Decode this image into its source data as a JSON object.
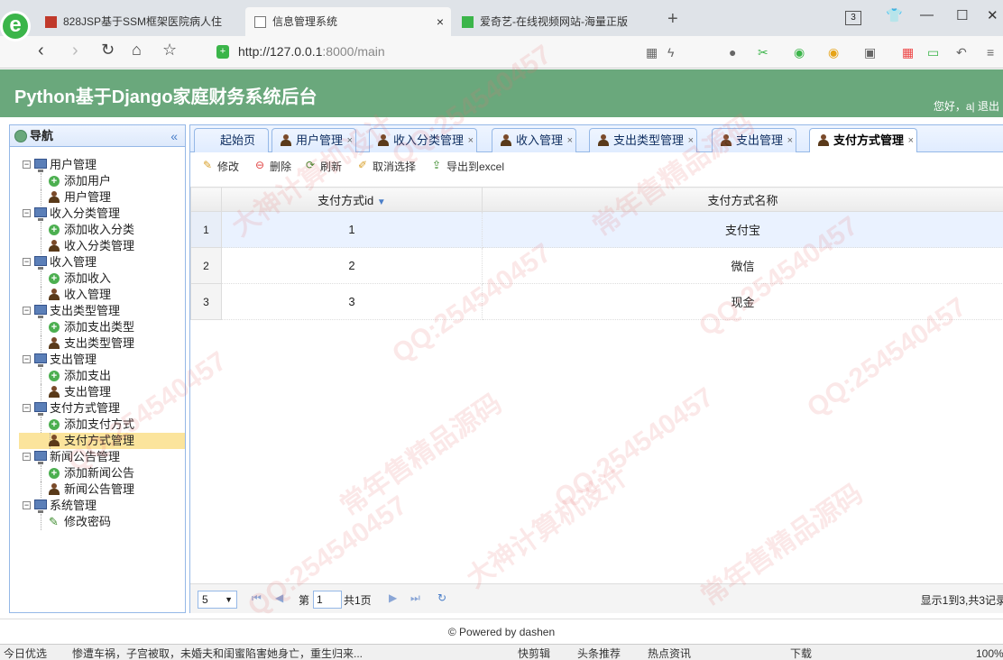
{
  "browser": {
    "tabs": [
      {
        "title": "828JSP基于SSM框架医院病人住",
        "active": false
      },
      {
        "title": "信息管理系统",
        "active": true
      },
      {
        "title": "爱奇艺-在线视频网站-海量正版",
        "active": false
      }
    ],
    "tab_count": "3",
    "url_host": "http://127.0.0.1",
    "url_rest": ":8000/main",
    "status_items": [
      "今日优选",
      "惨遭车祸，子宫被取，未婚夫和闺蜜陷害她身亡，重生归来...",
      "快剪辑",
      "头条推荐",
      "热点资讯",
      "下载",
      "100%"
    ]
  },
  "app": {
    "title": "Python基于Django家庭财务系统后台",
    "welcome": "您好，a| 退出"
  },
  "nav": {
    "heading": "导航",
    "groups": [
      {
        "label": "用户管理",
        "items": [
          {
            "label": "添加用户",
            "type": "add"
          },
          {
            "label": "用户管理",
            "type": "user"
          }
        ]
      },
      {
        "label": "收入分类管理",
        "items": [
          {
            "label": "添加收入分类",
            "type": "add"
          },
          {
            "label": "收入分类管理",
            "type": "user"
          }
        ]
      },
      {
        "label": "收入管理",
        "items": [
          {
            "label": "添加收入",
            "type": "add"
          },
          {
            "label": "收入管理",
            "type": "user"
          }
        ]
      },
      {
        "label": "支出类型管理",
        "items": [
          {
            "label": "添加支出类型",
            "type": "add"
          },
          {
            "label": "支出类型管理",
            "type": "user"
          }
        ]
      },
      {
        "label": "支出管理",
        "items": [
          {
            "label": "添加支出",
            "type": "add"
          },
          {
            "label": "支出管理",
            "type": "user"
          }
        ]
      },
      {
        "label": "支付方式管理",
        "items": [
          {
            "label": "添加支付方式",
            "type": "add"
          },
          {
            "label": "支付方式管理",
            "type": "user",
            "selected": true
          }
        ]
      },
      {
        "label": "新闻公告管理",
        "items": [
          {
            "label": "添加新闻公告",
            "type": "add"
          },
          {
            "label": "新闻公告管理",
            "type": "user"
          }
        ]
      },
      {
        "label": "系统管理",
        "items": [
          {
            "label": "修改密码",
            "type": "pen"
          }
        ]
      }
    ]
  },
  "tabs": [
    {
      "label": "起始页",
      "closable": false,
      "active": false
    },
    {
      "label": "用户管理",
      "closable": true,
      "active": false
    },
    {
      "label": "收入分类管理",
      "closable": true,
      "active": false
    },
    {
      "label": "收入管理",
      "closable": true,
      "active": false
    },
    {
      "label": "支出类型管理",
      "closable": true,
      "active": false
    },
    {
      "label": "支出管理",
      "closable": true,
      "active": false
    },
    {
      "label": "支付方式管理",
      "closable": true,
      "active": true
    }
  ],
  "toolbar": {
    "edit": "修改",
    "delete": "删除",
    "refresh": "刷新",
    "unselect": "取消选择",
    "export": "导出到excel"
  },
  "grid": {
    "columns": [
      "支付方式id",
      "支付方式名称"
    ],
    "rows": [
      {
        "num": "1",
        "id": "1",
        "name": "支付宝"
      },
      {
        "num": "2",
        "id": "2",
        "name": "微信"
      },
      {
        "num": "3",
        "id": "3",
        "name": "现金"
      }
    ]
  },
  "pager": {
    "page_size": "5",
    "page_label": "第",
    "page_value": "1",
    "total_pages": "共1页",
    "info": "显示1到3,共3记录"
  },
  "footer": "© Powered by dashen",
  "watermark": [
    "QQ:254540457",
    "常年售精品源码",
    "大神计算机设计"
  ]
}
